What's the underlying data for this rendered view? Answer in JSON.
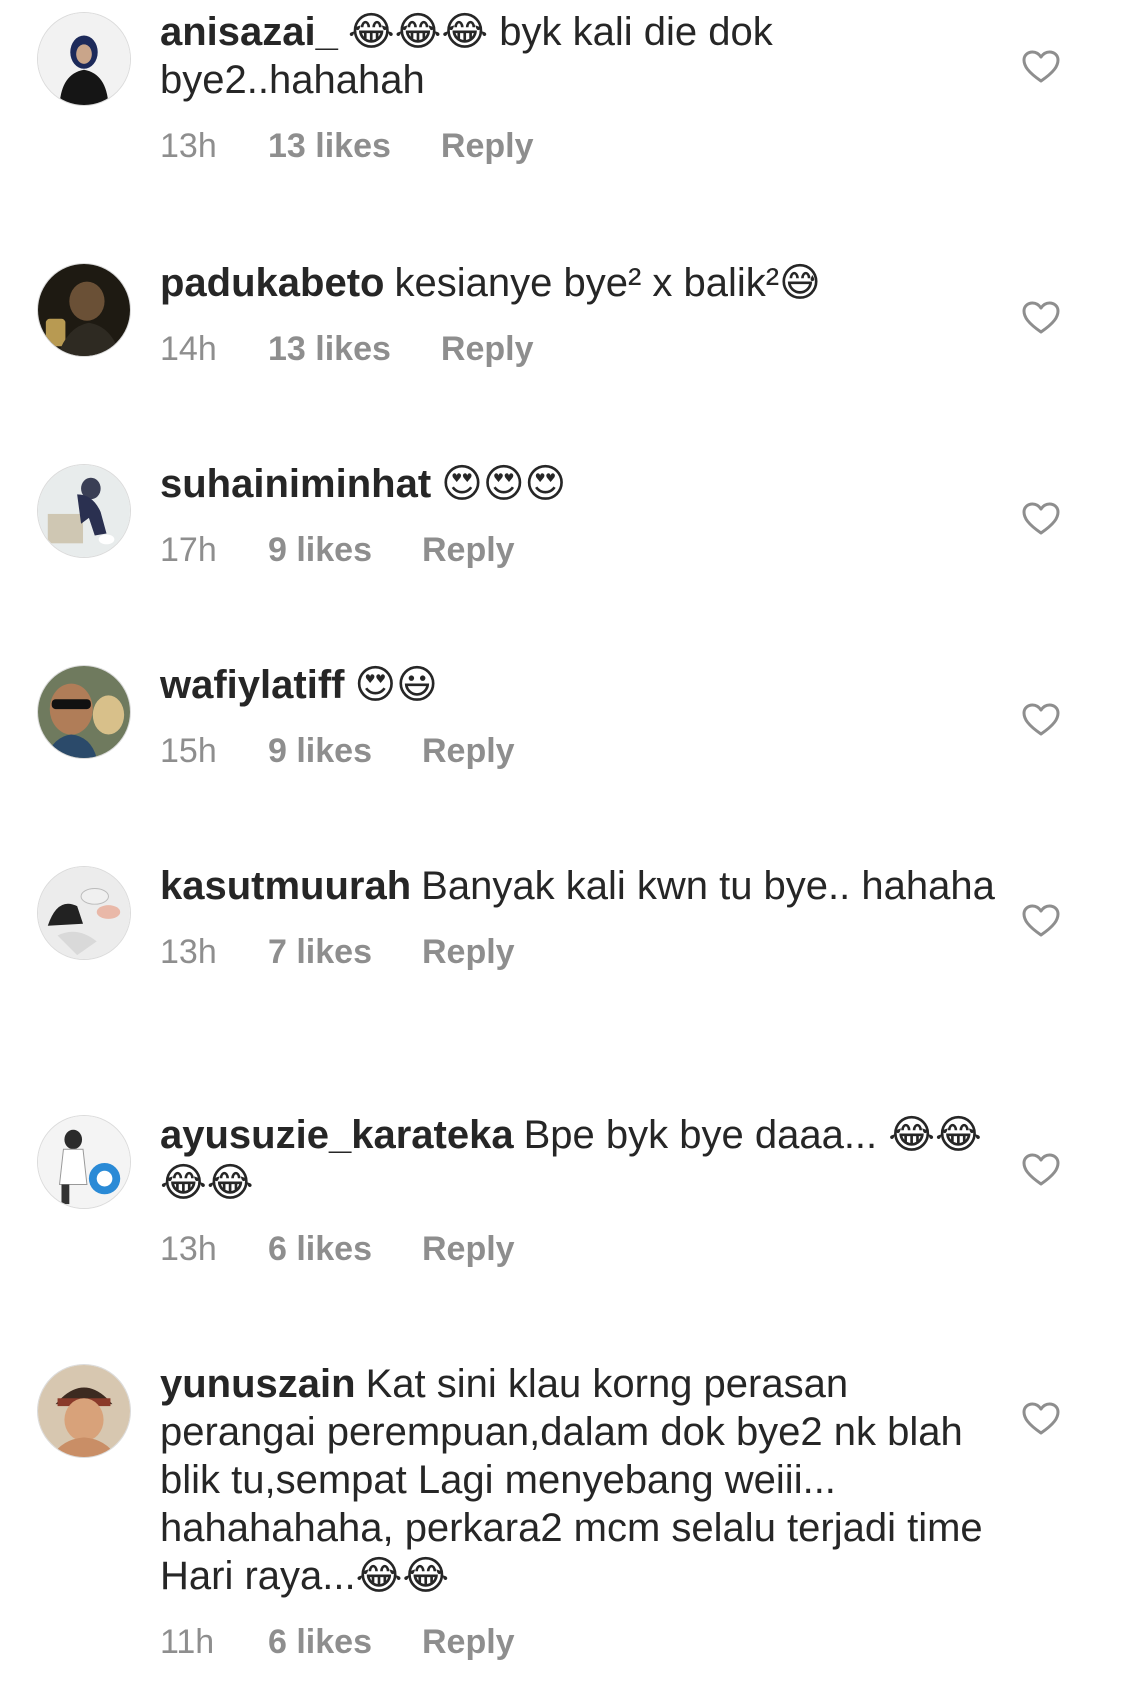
{
  "comments": [
    {
      "username": "anisazai_",
      "text": "😂😂😂 byk kali die dok bye2..hahahah",
      "time": "13h",
      "likes": "13 likes",
      "reply": "Reply"
    },
    {
      "username": "padukabeto",
      "text": "kesianye bye² x balik²😅",
      "time": "14h",
      "likes": "13 likes",
      "reply": "Reply"
    },
    {
      "username": "suhainiminhat",
      "text": "😍😍😍",
      "time": "17h",
      "likes": "9 likes",
      "reply": "Reply"
    },
    {
      "username": "wafiylatiff",
      "text": "😍😃",
      "time": "15h",
      "likes": "9 likes",
      "reply": "Reply"
    },
    {
      "username": "kasutmuurah",
      "text": "Banyak kali kwn tu bye.. hahaha",
      "time": "13h",
      "likes": "7 likes",
      "reply": "Reply"
    },
    {
      "username": "ayusuzie_karateka",
      "text": "Bpe byk bye daaa... 😂😂😂😂",
      "time": "13h",
      "likes": "6 likes",
      "reply": "Reply"
    },
    {
      "username": "yunuszain",
      "text": "Kat sini klau korng perasan perangai perempuan,dalam dok bye2 nk blah blik tu,sempat Lagi menyebang weiii... hahahahaha, perkara2 mcm selalu terjadi time Hari raya...😂😂",
      "time": "11h",
      "likes": "6 likes",
      "reply": "Reply"
    }
  ],
  "icons": {
    "like": "heart-outline-icon"
  },
  "colors": {
    "text": "#262626",
    "meta": "#8e8e8e",
    "heart": "#8e8e8e"
  }
}
